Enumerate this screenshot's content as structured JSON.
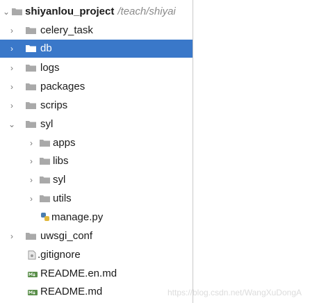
{
  "project": {
    "name": "shiyanlou_project",
    "path": "/teach/shiyai"
  },
  "items": [
    {
      "label": "celery_task"
    },
    {
      "label": "db"
    },
    {
      "label": "logs"
    },
    {
      "label": "packages"
    },
    {
      "label": "scrips"
    },
    {
      "label": "syl"
    },
    {
      "label": "apps"
    },
    {
      "label": "libs"
    },
    {
      "label": "syl"
    },
    {
      "label": "utils"
    },
    {
      "label": "manage.py"
    },
    {
      "label": "uwsgi_conf"
    },
    {
      "label": ".gitignore"
    },
    {
      "label": "README.en.md"
    },
    {
      "label": "README.md"
    }
  ],
  "watermark": "https://blog.csdn.net/WangXuDongA",
  "colors": {
    "selection": "#3a78c9",
    "folder": "#a9a9a9",
    "folder_selected": "#ffffff"
  }
}
